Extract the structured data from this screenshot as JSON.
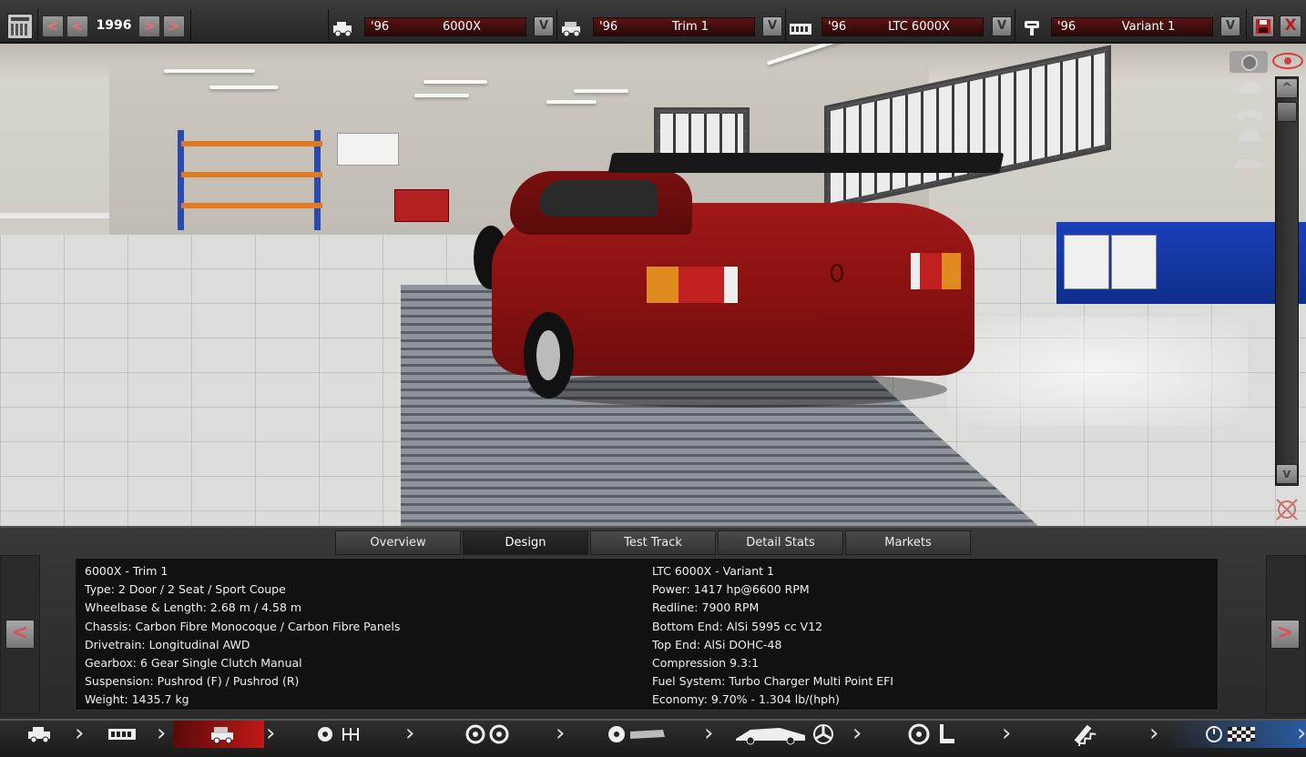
{
  "topbar": {
    "year": "1996",
    "prev_label": "<",
    "next_label": ">",
    "selectors": [
      {
        "icon": "car-model-icon",
        "year": "'96",
        "name": "6000X",
        "dropdown": "V"
      },
      {
        "icon": "trim-icon",
        "year": "'96",
        "name": "Trim 1",
        "dropdown": "V"
      },
      {
        "icon": "engine-block-icon",
        "year": "'96",
        "name": "LTC 6000X",
        "dropdown": "V"
      },
      {
        "icon": "piston-icon",
        "year": "'96",
        "name": "Variant 1",
        "dropdown": "V"
      }
    ],
    "close_label": "X"
  },
  "viewport": {
    "scroll_up": "^",
    "scroll_down": "v"
  },
  "tabs": [
    {
      "label": "Overview",
      "active": false
    },
    {
      "label": "Design",
      "active": true
    },
    {
      "label": "Test Track",
      "active": false
    },
    {
      "label": "Detail Stats",
      "active": false
    },
    {
      "label": "Markets",
      "active": false
    }
  ],
  "info": {
    "left": [
      "6000X - Trim 1",
      "Type: 2 Door / 2 Seat / Sport Coupe",
      "Wheelbase & Length: 2.68 m / 4.58 m",
      "Chassis: Carbon Fibre Monocoque / Carbon Fibre Panels",
      "Drivetrain: Longitudinal AWD",
      "Gearbox: 6 Gear Single Clutch Manual",
      "Suspension: Pushrod (F) / Pushrod (R)",
      "Weight: 1435.7 kg"
    ],
    "right": [
      "LTC 6000X - Variant 1",
      "Power: 1417 hp@6600 RPM",
      "Redline: 7900 RPM",
      "Bottom End: AlSi 5995 cc V12",
      "Top End: AlSi DOHC-48",
      "Compression 9.3:1",
      "Fuel System: Turbo Charger Multi Point EFI",
      "Economy: 9.70% - 1.304 lb/(hph)"
    ],
    "prev_arrow": "<",
    "next_arrow": ">"
  },
  "bottom_nav": [
    {
      "icon": "car-model-icon",
      "active": false
    },
    {
      "icon": "engine-block-icon",
      "active": false
    },
    {
      "icon": "trim-icon",
      "active": true
    },
    {
      "icon": "gearbox-icon",
      "active": false
    },
    {
      "icon": "wheels-icon",
      "active": false
    },
    {
      "icon": "brakes-icon",
      "active": false
    },
    {
      "icon": "aero-fan-icon",
      "active": false
    },
    {
      "icon": "interior-seat-icon",
      "active": false
    },
    {
      "icon": "suspension-icon",
      "active": false
    },
    {
      "icon": "test-finish-icon",
      "active": false
    }
  ],
  "colors": {
    "accent_red": "#c01818",
    "selector_bg": "#4a0f0f",
    "panel_bg": "#2a2a2a"
  }
}
